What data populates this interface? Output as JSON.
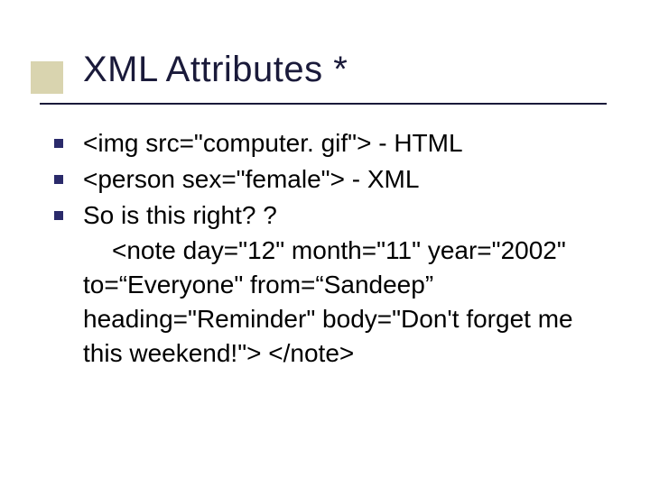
{
  "slide": {
    "title": "XML Attributes *",
    "bullets": [
      "<img src=\"computer. gif\"> - HTML",
      "<person sex=\"female\"> - XML",
      "So is this right? ?"
    ],
    "continuation_indent": "<note day=\"12\" month=\"11\" year=\"2002\"",
    "continuation_lines": [
      "to=“Everyone\" from=“Sandeep”",
      "heading=\"Reminder\" body=\"Don't forget me",
      "this weekend!\"> </note>"
    ]
  }
}
